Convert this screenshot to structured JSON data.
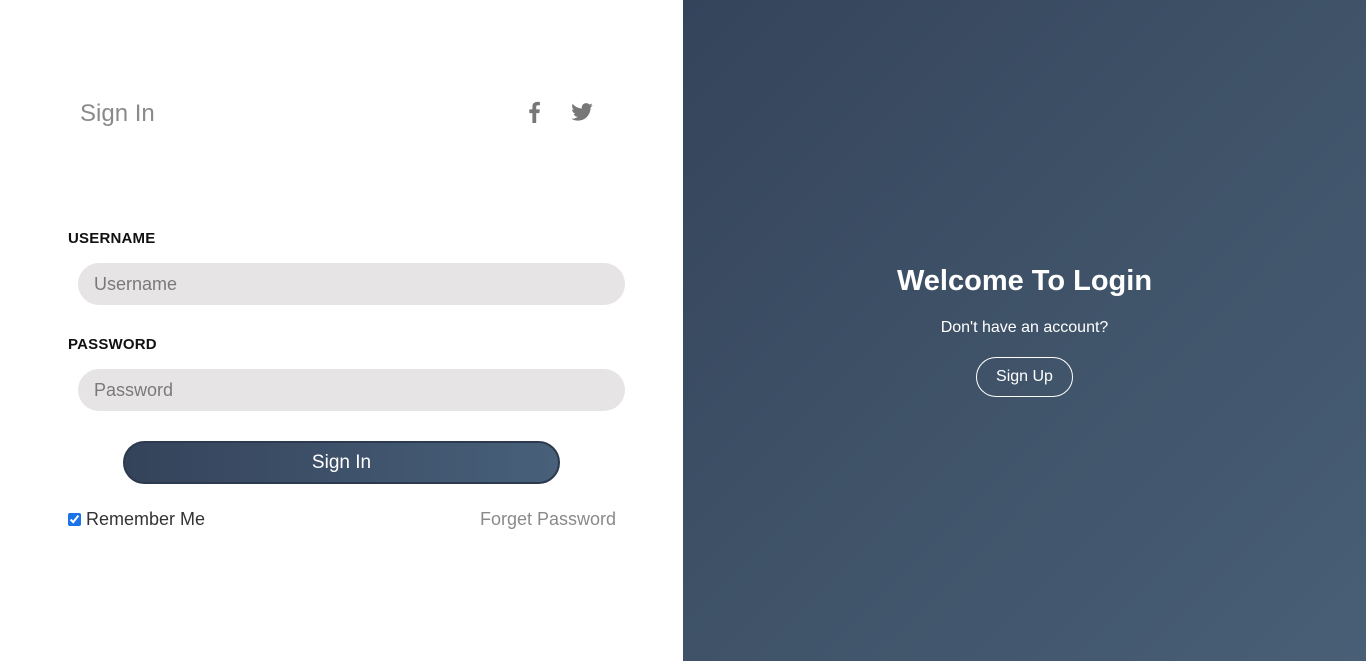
{
  "signin": {
    "heading": "Sign In",
    "social": [
      {
        "icon": "facebook-icon"
      },
      {
        "icon": "twitter-icon"
      }
    ],
    "username": {
      "label": "USERNAME",
      "placeholder": "Username",
      "value": ""
    },
    "password": {
      "label": "PASSWORD",
      "placeholder": "Password",
      "value": ""
    },
    "submit_label": "Sign In",
    "remember_label": "Remember Me",
    "remember_checked": true,
    "forget_label": "Forget Password"
  },
  "welcome": {
    "title": "Welcome To Login",
    "subtitle": "Don't have an account?",
    "signup_label": "Sign Up"
  },
  "colors": {
    "panel_gradient_start": "#34445b",
    "panel_gradient_end": "#485f76",
    "input_bg": "#e6e4e5",
    "muted_text": "#8a8a8a"
  }
}
